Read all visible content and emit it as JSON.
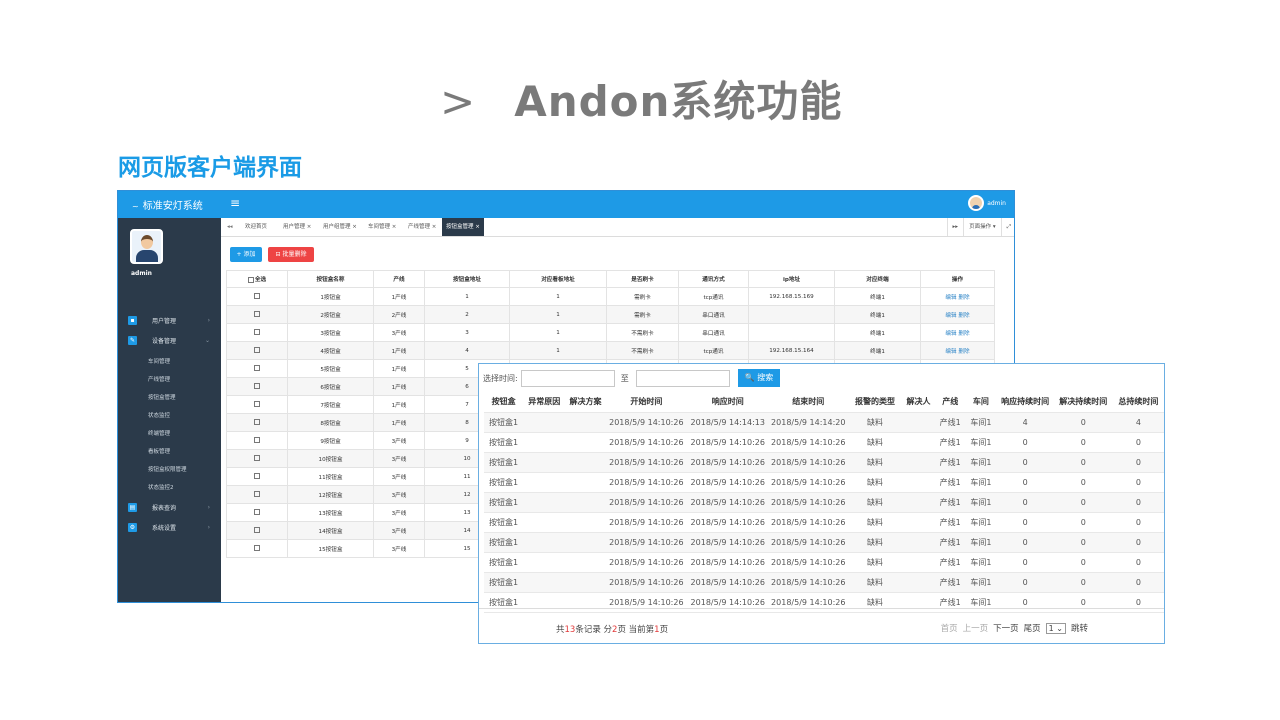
{
  "slide": {
    "arrow": ">",
    "title": "Andon系统功能",
    "subtitle": "网页版客户端界面"
  },
  "app": {
    "brand_logo": "~",
    "brand": "标准安灯系统",
    "menu_icon": "≡",
    "user": "admin",
    "sidebar": {
      "username": "admin",
      "items": [
        {
          "label": "用户管理",
          "icon": "user-icon",
          "chev": "›"
        },
        {
          "label": "设备管理",
          "icon": "wrench-icon",
          "chev": "⌄"
        },
        {
          "label": "报表查询",
          "icon": "chart-icon",
          "chev": "›"
        },
        {
          "label": "系统设置",
          "icon": "gear-icon",
          "chev": "›"
        }
      ],
      "subitems": [
        "车间管理",
        "产线管理",
        "按钮盒管理",
        "状态监控",
        "终端管理",
        "看板管理",
        "按钮盒权限管理",
        "状态监控2"
      ]
    },
    "tabs": {
      "prev": "◂◂",
      "items": [
        "欢迎首页",
        "用户管理 ×",
        "用户组管理 ×",
        "车间管理 ×",
        "产线管理 ×",
        "按钮盒管理 ×"
      ],
      "next": "▸▸",
      "page_ops": "页面操作 ▾",
      "expand": "⤢"
    },
    "toolbar": {
      "add": "+ 添加",
      "batch_delete": "⊟ 批量删除"
    },
    "table": {
      "headers": [
        "全选",
        "按钮盒名称",
        "产线",
        "按钮盒地址",
        "对应看板地址",
        "是否刷卡",
        "通讯方式",
        "ip地址",
        "对应终端",
        "操作"
      ],
      "rows": [
        [
          "1按钮盒",
          "1产线",
          "1",
          "1",
          "需刷卡",
          "tcp通讯",
          "192.168.15.169",
          "终端1",
          "编辑 删除"
        ],
        [
          "2按钮盒",
          "2产线",
          "2",
          "1",
          "需刷卡",
          "串口通讯",
          "",
          "终端1",
          "编辑 删除"
        ],
        [
          "3按钮盒",
          "3产线",
          "3",
          "1",
          "不需刷卡",
          "串口通讯",
          "",
          "终端1",
          "编辑 删除"
        ],
        [
          "4按钮盒",
          "1产线",
          "4",
          "1",
          "不需刷卡",
          "tcp通讯",
          "192.168.15.164",
          "终端1",
          "编辑 删除"
        ],
        [
          "5按钮盒",
          "1产线",
          "5",
          "",
          "",
          "",
          "",
          "",
          ""
        ],
        [
          "6按钮盒",
          "1产线",
          "6",
          "",
          "",
          "",
          "",
          "",
          ""
        ],
        [
          "7按钮盒",
          "1产线",
          "7",
          "",
          "",
          "",
          "",
          "",
          ""
        ],
        [
          "8按钮盒",
          "1产线",
          "8",
          "",
          "",
          "",
          "",
          "",
          ""
        ],
        [
          "9按钮盒",
          "3产线",
          "9",
          "",
          "",
          "",
          "",
          "",
          ""
        ],
        [
          "10按钮盒",
          "3产线",
          "10",
          "",
          "",
          "",
          "",
          "",
          ""
        ],
        [
          "11按钮盒",
          "3产线",
          "11",
          "",
          "",
          "",
          "",
          "",
          ""
        ],
        [
          "12按钮盒",
          "3产线",
          "12",
          "",
          "",
          "",
          "",
          "",
          ""
        ],
        [
          "13按钮盒",
          "3产线",
          "13",
          "",
          "",
          "",
          "",
          "",
          ""
        ],
        [
          "14按钮盒",
          "3产线",
          "14",
          "",
          "",
          "",
          "",
          "",
          ""
        ],
        [
          "15按钮盒",
          "3产线",
          "15",
          "",
          "",
          "",
          "",
          "",
          ""
        ]
      ]
    }
  },
  "report": {
    "filter_label": "选择时间:",
    "to_label": "至",
    "search_button": "🔍 搜索",
    "headers": [
      "按钮盒",
      "异常原因",
      "解决方案",
      "开始时间",
      "响应时间",
      "结束时间",
      "报警的类型",
      "解决人",
      "产线",
      "车间",
      "响应持续时间",
      "解决持续时间",
      "总持续时间"
    ],
    "rows": [
      [
        "按钮盒1",
        "",
        "",
        "2018/5/9 14:10:26",
        "2018/5/9 14:14:13",
        "2018/5/9 14:14:20",
        "缺料",
        "",
        "产线1",
        "车间1",
        "4",
        "0",
        "4"
      ],
      [
        "按钮盒1",
        "",
        "",
        "2018/5/9 14:10:26",
        "2018/5/9 14:10:26",
        "2018/5/9 14:10:26",
        "缺料",
        "",
        "产线1",
        "车间1",
        "0",
        "0",
        "0"
      ],
      [
        "按钮盒1",
        "",
        "",
        "2018/5/9 14:10:26",
        "2018/5/9 14:10:26",
        "2018/5/9 14:10:26",
        "缺料",
        "",
        "产线1",
        "车间1",
        "0",
        "0",
        "0"
      ],
      [
        "按钮盒1",
        "",
        "",
        "2018/5/9 14:10:26",
        "2018/5/9 14:10:26",
        "2018/5/9 14:10:26",
        "缺料",
        "",
        "产线1",
        "车间1",
        "0",
        "0",
        "0"
      ],
      [
        "按钮盒1",
        "",
        "",
        "2018/5/9 14:10:26",
        "2018/5/9 14:10:26",
        "2018/5/9 14:10:26",
        "缺料",
        "",
        "产线1",
        "车间1",
        "0",
        "0",
        "0"
      ],
      [
        "按钮盒1",
        "",
        "",
        "2018/5/9 14:10:26",
        "2018/5/9 14:10:26",
        "2018/5/9 14:10:26",
        "缺料",
        "",
        "产线1",
        "车间1",
        "0",
        "0",
        "0"
      ],
      [
        "按钮盒1",
        "",
        "",
        "2018/5/9 14:10:26",
        "2018/5/9 14:10:26",
        "2018/5/9 14:10:26",
        "缺料",
        "",
        "产线1",
        "车间1",
        "0",
        "0",
        "0"
      ],
      [
        "按钮盒1",
        "",
        "",
        "2018/5/9 14:10:26",
        "2018/5/9 14:10:26",
        "2018/5/9 14:10:26",
        "缺料",
        "",
        "产线1",
        "车间1",
        "0",
        "0",
        "0"
      ],
      [
        "按钮盒1",
        "",
        "",
        "2018/5/9 14:10:26",
        "2018/5/9 14:10:26",
        "2018/5/9 14:10:26",
        "缺料",
        "",
        "产线1",
        "车间1",
        "0",
        "0",
        "0"
      ],
      [
        "按钮盒1",
        "",
        "",
        "2018/5/9 14:10:26",
        "2018/5/9 14:10:26",
        "2018/5/9 14:10:26",
        "缺料",
        "",
        "产线1",
        "车间1",
        "0",
        "0",
        "0"
      ]
    ],
    "pager": {
      "total_prefix": "共",
      "total_records": "13",
      "records_mid": "条记录 分",
      "total_pages": "2",
      "pages_mid": "页 当前第",
      "current_page": "1",
      "page_suffix": "页",
      "first": "首页",
      "prev": "上一页",
      "next": "下一页",
      "last": "尾页",
      "page_select": "1 ⌄",
      "jump": "跳转"
    }
  }
}
